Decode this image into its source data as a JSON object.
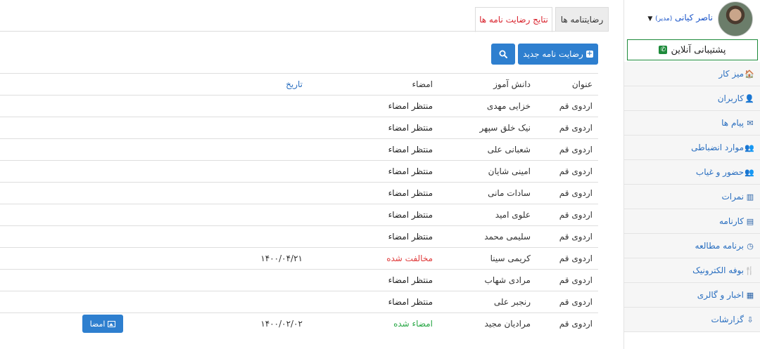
{
  "user": {
    "name": "ناصر کیانی",
    "role": "(مدیر)",
    "caret": "▼"
  },
  "support": {
    "label": "پشتیبانی آنلاین"
  },
  "menu": [
    {
      "label": "میز کار",
      "icon": "home-icon",
      "glyph": "🏠"
    },
    {
      "label": "کاربران",
      "icon": "user-icon",
      "glyph": "👤"
    },
    {
      "label": "پیام ها",
      "icon": "envelope-icon",
      "glyph": "✉"
    },
    {
      "label": "موارد انضباطی",
      "icon": "users-icon",
      "glyph": "👥"
    },
    {
      "label": "حضور و غیاب",
      "icon": "users-icon",
      "glyph": "👥"
    },
    {
      "label": "نمرات",
      "icon": "bar-chart-icon",
      "glyph": "▥"
    },
    {
      "label": "کارنامه",
      "icon": "card-icon",
      "glyph": "▤"
    },
    {
      "label": "برنامه مطالعه",
      "icon": "clock-icon",
      "glyph": "◷"
    },
    {
      "label": "بوفه الکترونیک",
      "icon": "cutlery-icon",
      "glyph": "🍴"
    },
    {
      "label": "اخبار و گالری",
      "icon": "film-icon",
      "glyph": "▦"
    },
    {
      "label": "گزارشات",
      "icon": "sort-icon",
      "glyph": "⇩"
    }
  ],
  "tabs": [
    {
      "label": "رضایتنامه ها"
    },
    {
      "label": "نتایج رضایت نامه ها"
    }
  ],
  "toolbar": {
    "new_label": "رضایت نامه جدید"
  },
  "table": {
    "headers": {
      "title": "عنوان",
      "student": "دانش آموز",
      "sign": "امضاء",
      "date": "تاریخ"
    },
    "sign_button_label": "امضا",
    "rows": [
      {
        "title": "اردوی قم",
        "student": "خزایی مهدی",
        "status": "منتظر امضاء",
        "state": "pending",
        "date": ""
      },
      {
        "title": "اردوی قم",
        "student": "نیک خلق سپهر",
        "status": "منتظر امضاء",
        "state": "pending",
        "date": ""
      },
      {
        "title": "اردوی قم",
        "student": "شعبانی علی",
        "status": "منتظر امضاء",
        "state": "pending",
        "date": ""
      },
      {
        "title": "اردوی قم",
        "student": "امینی شایان",
        "status": "منتظر امضاء",
        "state": "pending",
        "date": ""
      },
      {
        "title": "اردوی قم",
        "student": "سادات مانی",
        "status": "منتظر امضاء",
        "state": "pending",
        "date": ""
      },
      {
        "title": "اردوی قم",
        "student": "علوی امید",
        "status": "منتظر امضاء",
        "state": "pending",
        "date": ""
      },
      {
        "title": "اردوی قم",
        "student": "سلیمی محمد",
        "status": "منتظر امضاء",
        "state": "pending",
        "date": ""
      },
      {
        "title": "اردوی قم",
        "student": "کریمی سینا",
        "status": "مخالفت شده",
        "state": "rejected",
        "date": "۱۴۰۰/۰۴/۲۱"
      },
      {
        "title": "اردوی قم",
        "student": "مرادی شهاب",
        "status": "منتظر امضاء",
        "state": "pending",
        "date": ""
      },
      {
        "title": "اردوی قم",
        "student": "رنجبر علی",
        "status": "منتظر امضاء",
        "state": "pending",
        "date": ""
      },
      {
        "title": "اردوی قم",
        "student": "مرادیان مجید",
        "status": "امضاء شده",
        "state": "signed",
        "date": "۱۴۰۰/۰۲/۰۲",
        "has_button": true
      }
    ]
  },
  "colors": {
    "accent": "#2e7fcf",
    "link": "#2a6fc0",
    "danger": "#e03c3c",
    "success": "#28a745",
    "support_border": "#1d8a3a"
  }
}
